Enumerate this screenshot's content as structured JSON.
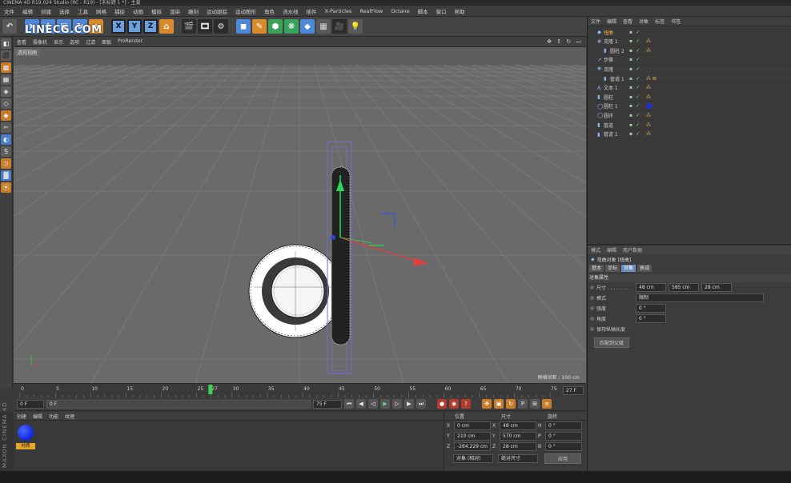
{
  "window": {
    "title": "CINEMA 4D R19.024 Studio (RC - R19) - [未标题 1 *] - 主要"
  },
  "menu": [
    "文件",
    "编辑",
    "创建",
    "选择",
    "工具",
    "网格",
    "捕捉",
    "动画",
    "模拟",
    "渲染",
    "雕刻",
    "运动跟踪",
    "运动图形",
    "角色",
    "流水线",
    "插件",
    "X-Particles",
    "RealFlow",
    "Octane",
    "脚本",
    "窗口",
    "帮助"
  ],
  "logo": "LINECG.COM",
  "toolbar": {
    "undo": "↶",
    "move": "+",
    "x": "X",
    "y": "Y",
    "z": "Z"
  },
  "viewport_menu": [
    "查看",
    "摄像机",
    "显示",
    "选项",
    "过滤",
    "面板",
    "ProRender"
  ],
  "viewport": {
    "label": "透视视图",
    "grid_spacing": "网格间距 : 100 cm"
  },
  "timeline": {
    "ticks": [
      "0",
      "5",
      "10",
      "15",
      "20",
      "25",
      "27",
      "30",
      "35",
      "40",
      "45",
      "50",
      "55",
      "60",
      "65",
      "70",
      "75"
    ],
    "current": 27,
    "end_field": "27 F"
  },
  "transport": {
    "start": "0 F",
    "min": "0 F",
    "end": "75 F",
    "max": "75 F"
  },
  "object_manager": {
    "menu": [
      "文件",
      "编辑",
      "查看",
      "对象",
      "标签",
      "书签"
    ],
    "objects": [
      {
        "name": "扭曲",
        "icon": "◆",
        "depth": 0,
        "selected": true
      },
      {
        "name": "克隆 1",
        "icon": "❋",
        "depth": 0,
        "tag": "⁂"
      },
      {
        "name": "圆柱 2",
        "icon": "▮",
        "depth": 1,
        "tag": "⁂"
      },
      {
        "name": "步骤",
        "icon": "↗",
        "depth": 0
      },
      {
        "name": "克隆",
        "icon": "❋",
        "depth": 0
      },
      {
        "name": "管道 1",
        "icon": "▮",
        "depth": 1,
        "tag": "⁂ ⊠"
      },
      {
        "name": "文本 1",
        "icon": "A",
        "depth": 0,
        "tag": "⁂"
      },
      {
        "name": "圆柱",
        "icon": "▮",
        "depth": 0,
        "tag": "⁂"
      },
      {
        "name": "圆柱 1",
        "icon": "◯",
        "depth": 0,
        "tag": "●",
        "tag_blue": true
      },
      {
        "name": "圆环",
        "icon": "◯",
        "depth": 0,
        "tag": "⁂"
      },
      {
        "name": "管道",
        "icon": "▮",
        "depth": 0,
        "tag": "⁂"
      },
      {
        "name": "管道 1",
        "icon": "▮",
        "depth": 0,
        "tag": "⁂"
      }
    ]
  },
  "attributes": {
    "menu": [
      "模式",
      "编辑",
      "用户数据"
    ],
    "title": "弯曲对象 [扭曲]",
    "tabs": [
      "基本",
      "坐标",
      "对象",
      "衰减"
    ],
    "active_tab": 2,
    "section": "对象属性",
    "rows": [
      {
        "label": "尺寸 . . . . . . .",
        "values": [
          "48 cm",
          "585 cm",
          "28 cm"
        ]
      },
      {
        "label": "模式",
        "values": [
          "限制"
        ]
      },
      {
        "label": "强度",
        "values": [
          "0 °"
        ]
      },
      {
        "label": "角度",
        "values": [
          "0 °"
        ]
      },
      {
        "label": "保持纵轴长度",
        "values": []
      }
    ],
    "button": "匹配到父级"
  },
  "material_manager": {
    "menu": [
      "创建",
      "编辑",
      "功能",
      "纹理"
    ],
    "material": {
      "name": "材质",
      "color": "#0a1fd8"
    },
    "brand": "MAXON CINEMA 4D"
  },
  "coordinates": {
    "headers": [
      "位置",
      "尺寸",
      "旋转"
    ],
    "rows": [
      {
        "pos_axis": "X",
        "pos": "0 cm",
        "size_axis": "X",
        "size": "48 cm",
        "rot_axis": "H",
        "rot": "0 °"
      },
      {
        "pos_axis": "Y",
        "pos": "210 cm",
        "size_axis": "Y",
        "size": "570 cm",
        "rot_axis": "P",
        "rot": "0 °"
      },
      {
        "pos_axis": "Z",
        "pos": "-264.229 cm",
        "size_axis": "Z",
        "size": "28 cm",
        "rot_axis": "B",
        "rot": "0 °"
      }
    ],
    "mode": "对象 (相对)",
    "size_mode": "绝对尺寸",
    "apply": "应用"
  }
}
